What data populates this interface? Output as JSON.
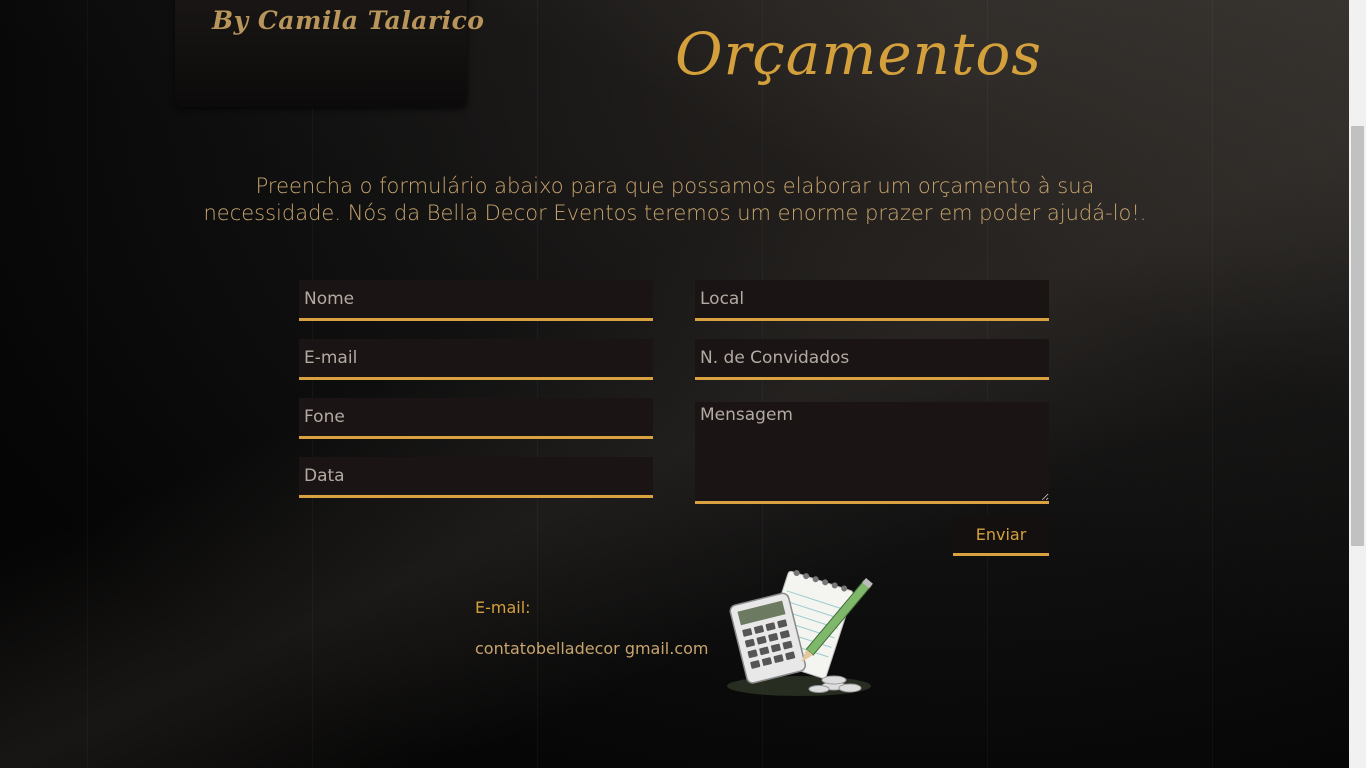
{
  "logo": {
    "text": "By Camila Talarico"
  },
  "page": {
    "title": "Orçamentos",
    "intro": "Preencha o formulário abaixo para que possamos elaborar um orçamento à sua necessidade. Nós da Bella Decor Eventos teremos um enorme prazer em poder ajudá-lo!."
  },
  "form": {
    "name_placeholder": "Nome",
    "email_placeholder": "E-mail",
    "phone_placeholder": "Fone",
    "date_placeholder": "Data",
    "location_placeholder": "Local",
    "guests_placeholder": "N. de Convidados",
    "message_placeholder": "Mensagem",
    "submit_label": "Enviar"
  },
  "contact": {
    "label": "E-mail:",
    "value": "contatobelladecor  gmail.com"
  },
  "icons": {
    "illustration": "calculator-notepad-icon"
  },
  "colors": {
    "accent": "#d4a03c",
    "field_bg": "#1a1414",
    "text": "#c9a56e"
  }
}
